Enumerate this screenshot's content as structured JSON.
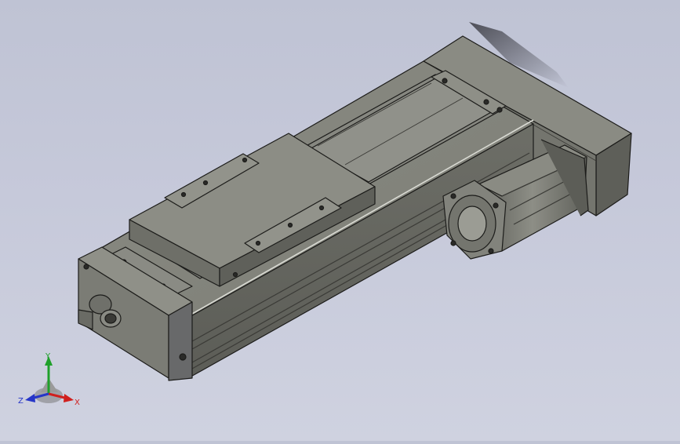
{
  "viewport": {
    "background_top": "#bfc3d4",
    "background_bottom": "#cfd2e0",
    "model_fill": "#7e7f77",
    "model_edge": "#1c1c1a"
  },
  "triad": {
    "x_label": "X",
    "y_label": "Y",
    "z_label": "Z",
    "x_color": "#d0201e",
    "y_color": "#1fa02a",
    "z_color": "#2636c8"
  }
}
